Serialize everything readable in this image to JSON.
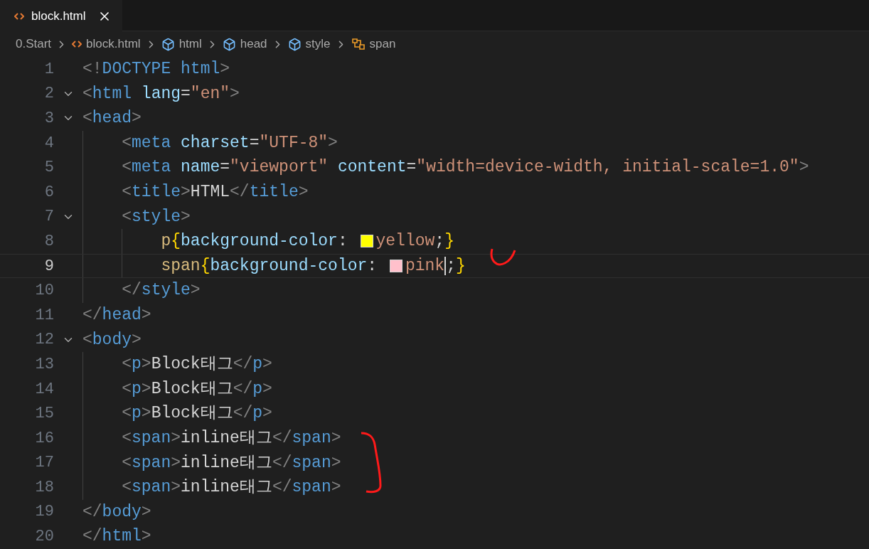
{
  "tab": {
    "label": "block.html",
    "selected": true
  },
  "breadcrumbs": [
    {
      "kind": "folder",
      "label": "0.Start"
    },
    {
      "kind": "file",
      "label": "block.html"
    },
    {
      "kind": "element",
      "label": "html"
    },
    {
      "kind": "element",
      "label": "head"
    },
    {
      "kind": "element",
      "label": "style"
    },
    {
      "kind": "selector",
      "label": "span"
    }
  ],
  "lines": [
    {
      "number": "1",
      "foldable": false,
      "current": false,
      "tokens": [
        {
          "kind": "punct",
          "text": "<!"
        },
        {
          "kind": "tag",
          "text": "DOCTYPE html"
        },
        {
          "kind": "punct",
          "text": ">"
        }
      ]
    },
    {
      "number": "2",
      "foldable": true,
      "current": false,
      "tokens": [
        {
          "kind": "punct",
          "text": "<"
        },
        {
          "kind": "tag",
          "text": "html"
        },
        {
          "kind": "attr",
          "text": " lang"
        },
        {
          "kind": "text",
          "text": "="
        },
        {
          "kind": "string",
          "text": "\"en\""
        },
        {
          "kind": "punct",
          "text": ">"
        }
      ]
    },
    {
      "number": "3",
      "foldable": true,
      "current": false,
      "tokens": [
        {
          "kind": "punct",
          "text": "<"
        },
        {
          "kind": "tag",
          "text": "head"
        },
        {
          "kind": "punct",
          "text": ">"
        }
      ]
    },
    {
      "number": "4",
      "foldable": false,
      "current": false,
      "tokens": [
        {
          "kind": "punct",
          "text": "    <"
        },
        {
          "kind": "tag",
          "text": "meta"
        },
        {
          "kind": "attr",
          "text": " charset"
        },
        {
          "kind": "text",
          "text": "="
        },
        {
          "kind": "string",
          "text": "\"UTF-8\""
        },
        {
          "kind": "punct",
          "text": ">"
        }
      ]
    },
    {
      "number": "5",
      "foldable": false,
      "current": false,
      "tokens": [
        {
          "kind": "punct",
          "text": "    <"
        },
        {
          "kind": "tag",
          "text": "meta"
        },
        {
          "kind": "attr",
          "text": " name"
        },
        {
          "kind": "text",
          "text": "="
        },
        {
          "kind": "string",
          "text": "\"viewport\""
        },
        {
          "kind": "attr",
          "text": " content"
        },
        {
          "kind": "text",
          "text": "="
        },
        {
          "kind": "string",
          "text": "\"width=device-width, initial-scale=1.0\""
        },
        {
          "kind": "punct",
          "text": ">"
        }
      ]
    },
    {
      "number": "6",
      "foldable": false,
      "current": false,
      "tokens": [
        {
          "kind": "punct",
          "text": "    <"
        },
        {
          "kind": "tag",
          "text": "title"
        },
        {
          "kind": "punct",
          "text": ">"
        },
        {
          "kind": "text",
          "text": "HTML"
        },
        {
          "kind": "punct",
          "text": "</"
        },
        {
          "kind": "tag",
          "text": "title"
        },
        {
          "kind": "punct",
          "text": ">"
        }
      ]
    },
    {
      "number": "7",
      "foldable": true,
      "current": false,
      "tokens": [
        {
          "kind": "punct",
          "text": "    <"
        },
        {
          "kind": "tag",
          "text": "style"
        },
        {
          "kind": "punct",
          "text": ">"
        }
      ]
    },
    {
      "number": "8",
      "foldable": false,
      "current": false,
      "tokens": [
        {
          "kind": "selector",
          "text": "        p"
        },
        {
          "kind": "brace",
          "text": "{"
        },
        {
          "kind": "prop",
          "text": "background-color"
        },
        {
          "kind": "text",
          "text": ": "
        },
        {
          "kind": "swatch",
          "color": "#ffff00"
        },
        {
          "kind": "value",
          "text": "yellow"
        },
        {
          "kind": "text",
          "text": ";"
        },
        {
          "kind": "brace",
          "text": "}"
        }
      ]
    },
    {
      "number": "9",
      "foldable": false,
      "current": true,
      "tokens": [
        {
          "kind": "selector",
          "text": "        span"
        },
        {
          "kind": "brace",
          "text": "{"
        },
        {
          "kind": "prop",
          "text": "background-color"
        },
        {
          "kind": "text",
          "text": ": "
        },
        {
          "kind": "swatch",
          "color": "#ffc0cb"
        },
        {
          "kind": "value",
          "text": "pink"
        },
        {
          "kind": "cursor"
        },
        {
          "kind": "text",
          "text": ";"
        },
        {
          "kind": "brace",
          "text": "}"
        }
      ]
    },
    {
      "number": "10",
      "foldable": false,
      "current": false,
      "tokens": [
        {
          "kind": "punct",
          "text": "    </"
        },
        {
          "kind": "tag",
          "text": "style"
        },
        {
          "kind": "punct",
          "text": ">"
        }
      ]
    },
    {
      "number": "11",
      "foldable": false,
      "current": false,
      "tokens": [
        {
          "kind": "punct",
          "text": "</"
        },
        {
          "kind": "tag",
          "text": "head"
        },
        {
          "kind": "punct",
          "text": ">"
        }
      ]
    },
    {
      "number": "12",
      "foldable": true,
      "current": false,
      "tokens": [
        {
          "kind": "punct",
          "text": "<"
        },
        {
          "kind": "tag",
          "text": "body"
        },
        {
          "kind": "punct",
          "text": ">"
        }
      ]
    },
    {
      "number": "13",
      "foldable": false,
      "current": false,
      "tokens": [
        {
          "kind": "punct",
          "text": "    <"
        },
        {
          "kind": "tag",
          "text": "p"
        },
        {
          "kind": "punct",
          "text": ">"
        },
        {
          "kind": "text",
          "text": "Block태그"
        },
        {
          "kind": "punct",
          "text": "</"
        },
        {
          "kind": "tag",
          "text": "p"
        },
        {
          "kind": "punct",
          "text": ">"
        }
      ]
    },
    {
      "number": "14",
      "foldable": false,
      "current": false,
      "tokens": [
        {
          "kind": "punct",
          "text": "    <"
        },
        {
          "kind": "tag",
          "text": "p"
        },
        {
          "kind": "punct",
          "text": ">"
        },
        {
          "kind": "text",
          "text": "Block태그"
        },
        {
          "kind": "punct",
          "text": "</"
        },
        {
          "kind": "tag",
          "text": "p"
        },
        {
          "kind": "punct",
          "text": ">"
        }
      ]
    },
    {
      "number": "15",
      "foldable": false,
      "current": false,
      "tokens": [
        {
          "kind": "punct",
          "text": "    <"
        },
        {
          "kind": "tag",
          "text": "p"
        },
        {
          "kind": "punct",
          "text": ">"
        },
        {
          "kind": "text",
          "text": "Block태그"
        },
        {
          "kind": "punct",
          "text": "</"
        },
        {
          "kind": "tag",
          "text": "p"
        },
        {
          "kind": "punct",
          "text": ">"
        }
      ]
    },
    {
      "number": "16",
      "foldable": false,
      "current": false,
      "tokens": [
        {
          "kind": "punct",
          "text": "    <"
        },
        {
          "kind": "tag",
          "text": "span"
        },
        {
          "kind": "punct",
          "text": ">"
        },
        {
          "kind": "text",
          "text": "inline태그"
        },
        {
          "kind": "punct",
          "text": "</"
        },
        {
          "kind": "tag",
          "text": "span"
        },
        {
          "kind": "punct",
          "text": ">"
        }
      ]
    },
    {
      "number": "17",
      "foldable": false,
      "current": false,
      "tokens": [
        {
          "kind": "punct",
          "text": "    <"
        },
        {
          "kind": "tag",
          "text": "span"
        },
        {
          "kind": "punct",
          "text": ">"
        },
        {
          "kind": "text",
          "text": "inline태그"
        },
        {
          "kind": "punct",
          "text": "</"
        },
        {
          "kind": "tag",
          "text": "span"
        },
        {
          "kind": "punct",
          "text": ">"
        }
      ]
    },
    {
      "number": "18",
      "foldable": false,
      "current": false,
      "tokens": [
        {
          "kind": "punct",
          "text": "    <"
        },
        {
          "kind": "tag",
          "text": "span"
        },
        {
          "kind": "punct",
          "text": ">"
        },
        {
          "kind": "text",
          "text": "inline태그"
        },
        {
          "kind": "punct",
          "text": "</"
        },
        {
          "kind": "tag",
          "text": "span"
        },
        {
          "kind": "punct",
          "text": ">"
        }
      ]
    },
    {
      "number": "19",
      "foldable": false,
      "current": false,
      "tokens": [
        {
          "kind": "punct",
          "text": "</"
        },
        {
          "kind": "tag",
          "text": "body"
        },
        {
          "kind": "punct",
          "text": ">"
        }
      ]
    },
    {
      "number": "20",
      "foldable": false,
      "current": false,
      "tokens": [
        {
          "kind": "punct",
          "text": "</"
        },
        {
          "kind": "tag",
          "text": "html"
        },
        {
          "kind": "punct",
          "text": ">"
        }
      ]
    }
  ]
}
